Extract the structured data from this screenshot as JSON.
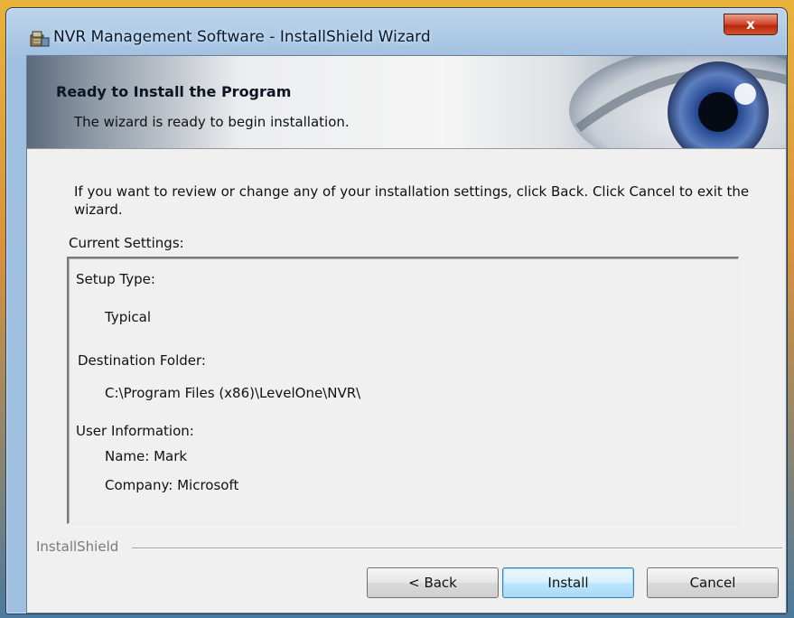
{
  "window": {
    "title": "NVR Management Software - InstallShield Wizard",
    "close_label": "x"
  },
  "banner": {
    "title": "Ready to Install the Program",
    "subtitle": "The wizard is ready to begin installation."
  },
  "intro_text": "If you want to review or change any of your installation settings, click Back. Click Cancel to exit the wizard.",
  "settings": {
    "label": "Current Settings:",
    "setup_type_label": "Setup Type:",
    "setup_type_value": "Typical",
    "destination_label": "Destination Folder:",
    "destination_value": "C:\\Program Files (x86)\\LevelOne\\NVR\\",
    "user_info_label": "User Information:",
    "name_line": "Name: Mark",
    "company_line": "Company: Microsoft"
  },
  "footer": {
    "brand": "InstallShield"
  },
  "buttons": {
    "back": "< Back",
    "install": "Install",
    "cancel": "Cancel"
  },
  "colors": {
    "close_button": "#c8391c",
    "default_button_border": "#3c7fb1",
    "dialog_background": "#f0f0f0"
  },
  "icons": {
    "title": "installer-icon",
    "banner_image": "eye-icon"
  }
}
